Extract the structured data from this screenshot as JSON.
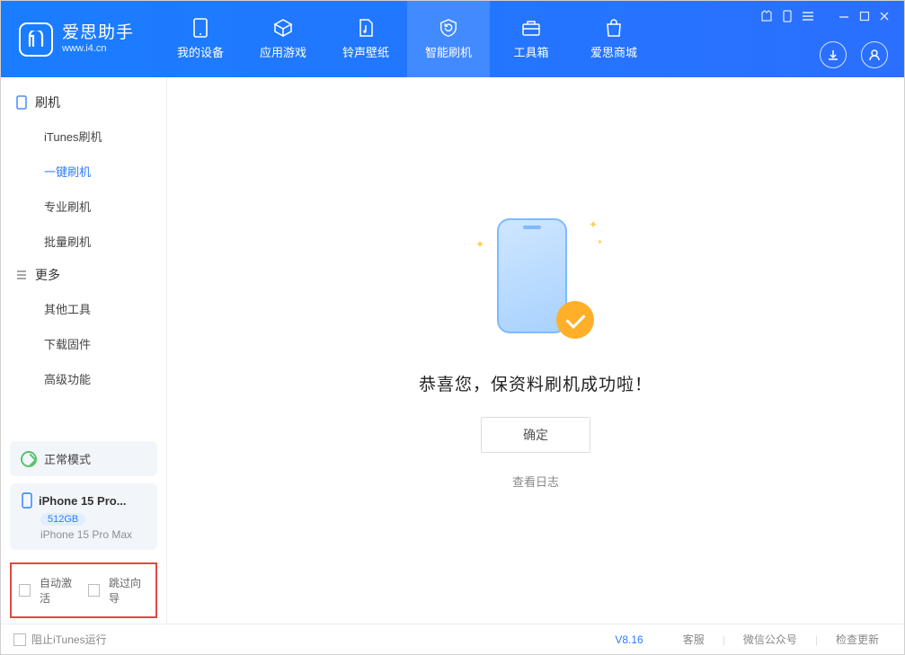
{
  "app": {
    "name": "爱思助手",
    "url": "www.i4.cn"
  },
  "tabs": [
    {
      "label": "我的设备"
    },
    {
      "label": "应用游戏"
    },
    {
      "label": "铃声壁纸"
    },
    {
      "label": "智能刷机"
    },
    {
      "label": "工具箱"
    },
    {
      "label": "爱思商城"
    }
  ],
  "sidebar": {
    "section1_title": "刷机",
    "section1_items": [
      "iTunes刷机",
      "一键刷机",
      "专业刷机",
      "批量刷机"
    ],
    "section2_title": "更多",
    "section2_items": [
      "其他工具",
      "下载固件",
      "高级功能"
    ]
  },
  "status": {
    "mode": "正常模式"
  },
  "device": {
    "name": "iPhone 15 Pro...",
    "storage": "512GB",
    "model": "iPhone 15 Pro Max"
  },
  "checks": {
    "auto_activate": "自动激活",
    "skip_wizard": "跳过向导"
  },
  "main": {
    "message": "恭喜您，保资料刷机成功啦！",
    "ok": "确定",
    "log": "查看日志"
  },
  "footer": {
    "block_itunes": "阻止iTunes运行",
    "version": "V8.16",
    "support": "客服",
    "wechat": "微信公众号",
    "update": "检查更新"
  }
}
